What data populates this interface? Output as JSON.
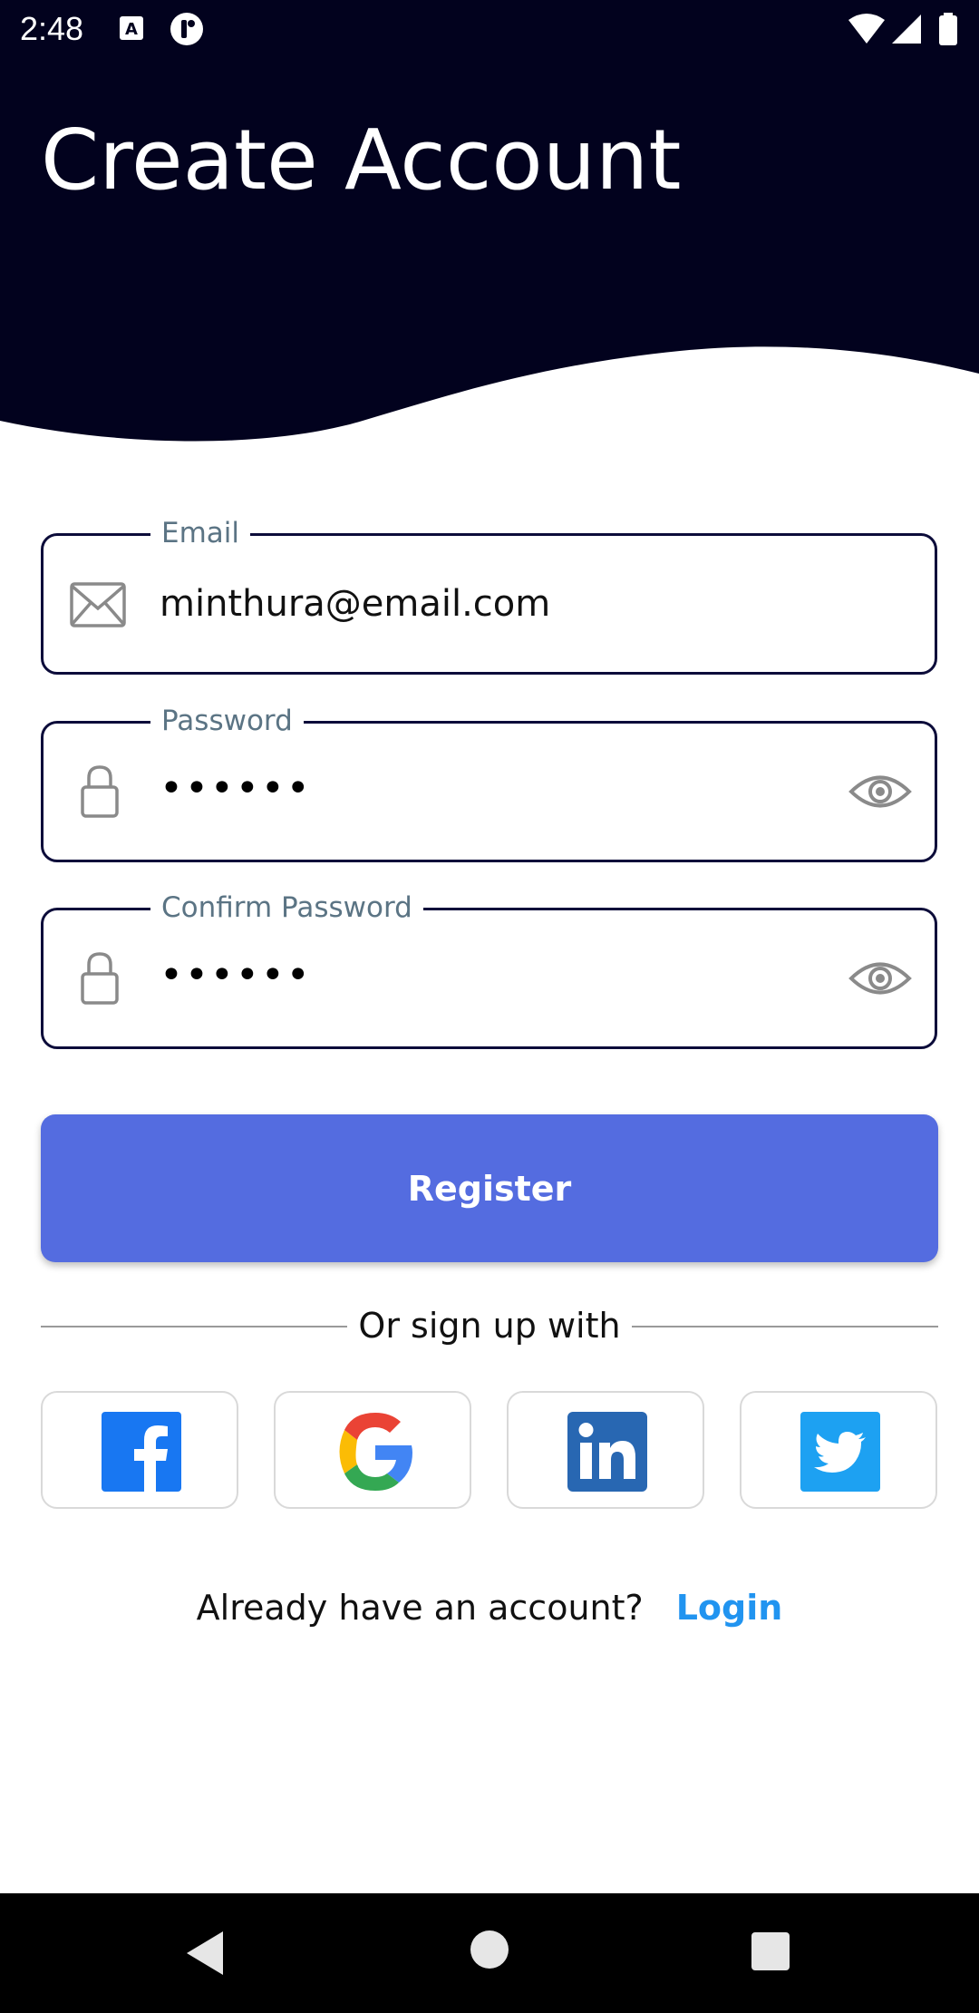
{
  "status_bar": {
    "time": "2:48",
    "icons": [
      "keyboard-a-icon",
      "app-notification-icon",
      "wifi-icon",
      "signal-icon",
      "battery-icon"
    ]
  },
  "header": {
    "title": "Create Account",
    "background_color": "#02021e"
  },
  "form": {
    "email": {
      "label": "Email",
      "value": "minthura@email.com",
      "icon": "mail-icon"
    },
    "password": {
      "label": "Password",
      "masked_value": "••••••",
      "icon": "lock-icon",
      "toggle_icon": "eye-icon"
    },
    "confirm_password": {
      "label": "Confirm Password",
      "masked_value": "••••••",
      "icon": "lock-icon",
      "toggle_icon": "eye-icon"
    },
    "register_label": "Register",
    "register_color": "#546ce0"
  },
  "divider": {
    "text": "Or sign up with"
  },
  "social": [
    {
      "name": "facebook",
      "icon": "facebook-icon",
      "color": "#1877f2"
    },
    {
      "name": "google",
      "icon": "google-icon",
      "color": "#4285f4"
    },
    {
      "name": "linkedin",
      "icon": "linkedin-icon",
      "color": "#2867b2"
    },
    {
      "name": "twitter",
      "icon": "twitter-icon",
      "color": "#1da1f2"
    }
  ],
  "footer": {
    "question": "Already have an account?",
    "login_label": "Login",
    "login_color": "#2194f0"
  },
  "nav_bar": {
    "icons": [
      "back-icon",
      "home-icon",
      "recents-icon"
    ]
  }
}
